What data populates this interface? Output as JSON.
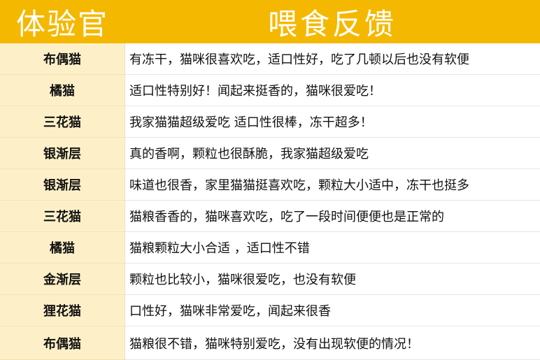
{
  "header": {
    "left": "体验官",
    "right": "喂食反馈"
  },
  "rows": [
    {
      "name": "布偶猫",
      "feedback": "有冻干，猫咪很喜欢吃，适口性好，吃了几顿以后也没有软便"
    },
    {
      "name": "橘猫",
      "feedback": "适口性特别好！闻起来挺香的，猫咪很爱吃！"
    },
    {
      "name": "三花猫",
      "feedback": "我家猫猫超级爱吃 适口性很棒，冻干超多！"
    },
    {
      "name": "银渐层",
      "feedback": "真的香啊，颗粒也很酥脆，我家猫超级爱吃"
    },
    {
      "name": "银渐层",
      "feedback": "味道也很香，家里猫猫挺喜欢吃，颗粒大小适中，冻干也挺多"
    },
    {
      "name": "三花猫",
      "feedback": "猫粮香香的，猫咪喜欢吃，吃了一段时间便便也是正常的"
    },
    {
      "name": "橘猫",
      "feedback": "猫粮颗粒大小合适 ，适口性不错"
    },
    {
      "name": "金渐层",
      "feedback": "颗粒也比较小，猫咪很爱吃，也没有软便"
    },
    {
      "name": "狸花猫",
      "feedback": "口性好，猫咪非常爱吃，闻起来很香"
    },
    {
      "name": "布偶猫",
      "feedback": "猫粮很不错，猫咪特别爱吃，没有出现软便的情况！"
    }
  ],
  "colors": {
    "header_bg": "#f5b800",
    "name_bg": "#fdf0c8",
    "header_text": "#ffffff"
  }
}
